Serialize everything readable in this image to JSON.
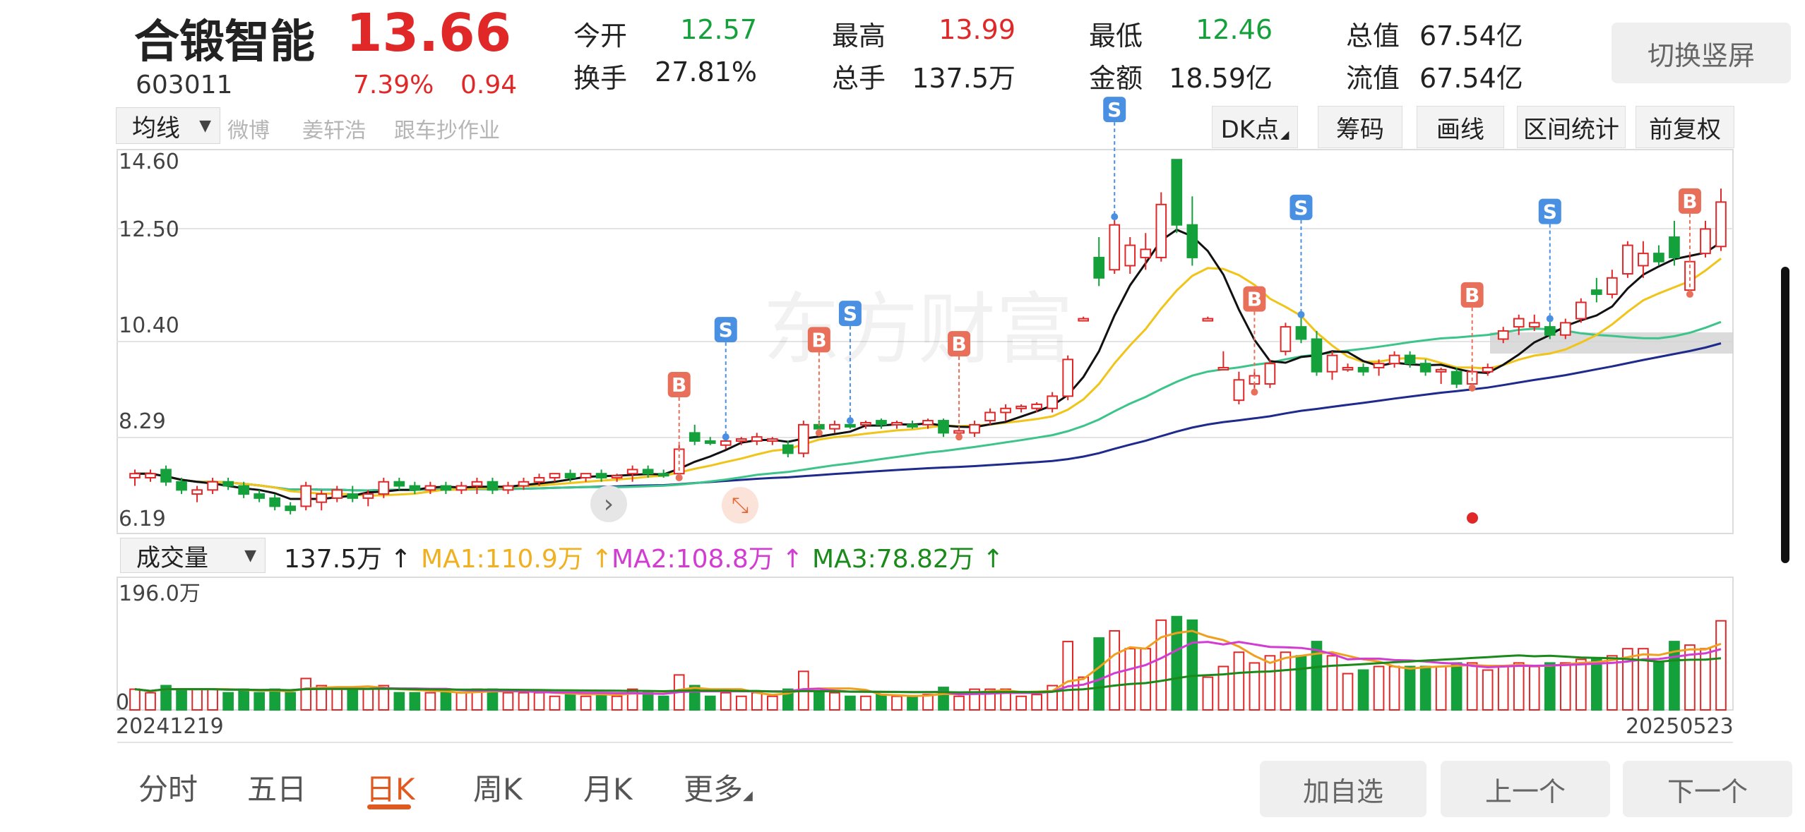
{
  "stock": {
    "name": "合锻智能",
    "price": "13.66",
    "code": "603011",
    "change_pct": "7.39%",
    "change_amt": "0.94"
  },
  "quote": [
    {
      "label": "今开",
      "value": "12.57",
      "color": "green"
    },
    {
      "label": "最高",
      "value": "13.99",
      "color": "red"
    },
    {
      "label": "最低",
      "value": "12.46",
      "color": "green"
    },
    {
      "label": "总值",
      "value": "67.54亿",
      "color": "black"
    },
    {
      "label": "换手",
      "value": "27.81%",
      "color": "black"
    },
    {
      "label": "总手",
      "value": "137.5万",
      "color": "black"
    },
    {
      "label": "金额",
      "value": "18.59亿",
      "color": "black"
    },
    {
      "label": "流值",
      "value": "67.54亿",
      "color": "black"
    }
  ],
  "switch_button": "切换竖屏",
  "chart_toolbar": {
    "ma_selector": "均线",
    "faded_tags": [
      "微博",
      "姜轩浩",
      "跟车抄作业"
    ],
    "buttons": [
      "DK点",
      "筹码",
      "画线",
      "区间统计",
      "前复权"
    ]
  },
  "price_axis": [
    "14.60",
    "12.50",
    "10.40",
    "8.29",
    "6.19"
  ],
  "watermark": "东方财富",
  "volume_panel": {
    "selector": "成交量",
    "current": "137.5万",
    "ma1": "MA1:110.9万",
    "ma2": "MA2:108.8万",
    "ma3": "MA3:78.82万",
    "axis_top": "196.0万",
    "axis_zero": "0"
  },
  "date_range": {
    "start": "20241219",
    "end": "20250523"
  },
  "period_tabs": [
    "分时",
    "五日",
    "日K",
    "周K",
    "月K",
    "更多"
  ],
  "active_tab": "日K",
  "bottom_buttons": [
    "加自选",
    "上一个",
    "下一个"
  ],
  "colors": {
    "up": "#e02828",
    "down": "#14a03a",
    "ma_black": "#111111",
    "ma_yellow": "#f0c419",
    "ma_teal": "#3cc48a",
    "ma_navy": "#1e2a8c",
    "vol_ma1": "#f0a020",
    "vol_ma2": "#d23cd2",
    "vol_ma3": "#1a8a1a",
    "buy_signal": "#e8705a",
    "sell_signal": "#4a90e2",
    "active_tab": "#e05a20"
  },
  "chart_data": {
    "type": "candlestick",
    "x_start": "20241219",
    "x_end": "20250523",
    "ylim": [
      6.19,
      14.6
    ],
    "candles": [
      {
        "o": 6.9,
        "h": 7.1,
        "l": 6.7,
        "c": 7.0
      },
      {
        "o": 6.9,
        "h": 7.1,
        "l": 6.8,
        "c": 7.0
      },
      {
        "o": 7.1,
        "h": 7.2,
        "l": 6.7,
        "c": 6.8
      },
      {
        "o": 6.8,
        "h": 6.9,
        "l": 6.5,
        "c": 6.6
      },
      {
        "o": 6.5,
        "h": 6.7,
        "l": 6.3,
        "c": 6.6
      },
      {
        "o": 6.6,
        "h": 6.9,
        "l": 6.5,
        "c": 6.8
      },
      {
        "o": 6.8,
        "h": 6.9,
        "l": 6.6,
        "c": 6.7
      },
      {
        "o": 6.7,
        "h": 6.8,
        "l": 6.4,
        "c": 6.5
      },
      {
        "o": 6.5,
        "h": 6.6,
        "l": 6.3,
        "c": 6.4
      },
      {
        "o": 6.4,
        "h": 6.5,
        "l": 6.1,
        "c": 6.2
      },
      {
        "o": 6.2,
        "h": 6.3,
        "l": 6.0,
        "c": 6.1
      },
      {
        "o": 6.2,
        "h": 6.8,
        "l": 6.1,
        "c": 6.7
      },
      {
        "o": 6.3,
        "h": 6.6,
        "l": 6.1,
        "c": 6.5
      },
      {
        "o": 6.4,
        "h": 6.7,
        "l": 6.3,
        "c": 6.6
      },
      {
        "o": 6.5,
        "h": 6.7,
        "l": 6.3,
        "c": 6.4
      },
      {
        "o": 6.4,
        "h": 6.6,
        "l": 6.2,
        "c": 6.5
      },
      {
        "o": 6.5,
        "h": 6.9,
        "l": 6.4,
        "c": 6.8
      },
      {
        "o": 6.8,
        "h": 6.9,
        "l": 6.6,
        "c": 6.7
      },
      {
        "o": 6.7,
        "h": 6.8,
        "l": 6.5,
        "c": 6.6
      },
      {
        "o": 6.6,
        "h": 6.8,
        "l": 6.5,
        "c": 6.7
      },
      {
        "o": 6.7,
        "h": 6.8,
        "l": 6.5,
        "c": 6.6
      },
      {
        "o": 6.6,
        "h": 6.8,
        "l": 6.5,
        "c": 6.7
      },
      {
        "o": 6.7,
        "h": 6.9,
        "l": 6.5,
        "c": 6.8
      },
      {
        "o": 6.8,
        "h": 6.9,
        "l": 6.5,
        "c": 6.6
      },
      {
        "o": 6.6,
        "h": 6.8,
        "l": 6.5,
        "c": 6.7
      },
      {
        "o": 6.7,
        "h": 6.9,
        "l": 6.6,
        "c": 6.8
      },
      {
        "o": 6.8,
        "h": 7.0,
        "l": 6.7,
        "c": 6.9
      },
      {
        "o": 6.9,
        "h": 7.0,
        "l": 6.8,
        "c": 7.0
      },
      {
        "o": 7.0,
        "h": 7.1,
        "l": 6.8,
        "c": 6.9
      },
      {
        "o": 6.9,
        "h": 7.0,
        "l": 6.8,
        "c": 7.0
      },
      {
        "o": 7.0,
        "h": 7.1,
        "l": 6.8,
        "c": 6.9
      },
      {
        "o": 6.9,
        "h": 7.0,
        "l": 6.8,
        "c": 6.95
      },
      {
        "o": 7.0,
        "h": 7.2,
        "l": 6.8,
        "c": 7.1
      },
      {
        "o": 7.1,
        "h": 7.2,
        "l": 6.9,
        "c": 7.0
      },
      {
        "o": 7.0,
        "h": 7.1,
        "l": 6.9,
        "c": 6.95
      },
      {
        "o": 7.0,
        "h": 7.7,
        "l": 6.9,
        "c": 7.6
      },
      {
        "o": 8.0,
        "h": 8.2,
        "l": 7.7,
        "c": 7.8
      },
      {
        "o": 7.8,
        "h": 7.9,
        "l": 7.7,
        "c": 7.75
      },
      {
        "o": 7.7,
        "h": 7.9,
        "l": 7.6,
        "c": 7.8
      },
      {
        "o": 7.8,
        "h": 7.9,
        "l": 7.7,
        "c": 7.85
      },
      {
        "o": 7.8,
        "h": 8.0,
        "l": 7.7,
        "c": 7.9
      },
      {
        "o": 7.8,
        "h": 7.9,
        "l": 7.7,
        "c": 7.85
      },
      {
        "o": 7.7,
        "h": 7.8,
        "l": 7.4,
        "c": 7.5
      },
      {
        "o": 7.5,
        "h": 8.3,
        "l": 7.4,
        "c": 8.2
      },
      {
        "o": 8.2,
        "h": 8.3,
        "l": 8.0,
        "c": 8.1
      },
      {
        "o": 8.1,
        "h": 8.3,
        "l": 8.0,
        "c": 8.2
      },
      {
        "o": 8.2,
        "h": 8.3,
        "l": 8.1,
        "c": 8.15
      },
      {
        "o": 8.2,
        "h": 8.3,
        "l": 8.1,
        "c": 8.25
      },
      {
        "o": 8.3,
        "h": 8.35,
        "l": 8.1,
        "c": 8.2
      },
      {
        "o": 8.2,
        "h": 8.3,
        "l": 8.1,
        "c": 8.25
      },
      {
        "o": 8.2,
        "h": 8.3,
        "l": 8.1,
        "c": 8.15
      },
      {
        "o": 8.2,
        "h": 8.35,
        "l": 8.1,
        "c": 8.3
      },
      {
        "o": 8.3,
        "h": 8.35,
        "l": 7.9,
        "c": 8.0
      },
      {
        "o": 8.0,
        "h": 8.1,
        "l": 7.9,
        "c": 8.05
      },
      {
        "o": 8.0,
        "h": 8.3,
        "l": 7.9,
        "c": 8.2
      },
      {
        "o": 8.3,
        "h": 8.6,
        "l": 8.2,
        "c": 8.5
      },
      {
        "o": 8.5,
        "h": 8.7,
        "l": 8.3,
        "c": 8.6
      },
      {
        "o": 8.6,
        "h": 8.7,
        "l": 8.5,
        "c": 8.65
      },
      {
        "o": 8.6,
        "h": 8.75,
        "l": 8.5,
        "c": 8.7
      },
      {
        "o": 8.6,
        "h": 9.0,
        "l": 8.5,
        "c": 8.9
      },
      {
        "o": 8.9,
        "h": 9.9,
        "l": 8.8,
        "c": 9.8
      },
      {
        "o": 10.8,
        "h": 10.85,
        "l": 10.75,
        "c": 10.8
      },
      {
        "o": 12.3,
        "h": 12.8,
        "l": 11.6,
        "c": 11.8
      },
      {
        "o": 12.0,
        "h": 13.3,
        "l": 11.9,
        "c": 13.1
      },
      {
        "o": 12.1,
        "h": 12.8,
        "l": 11.9,
        "c": 12.6
      },
      {
        "o": 12.3,
        "h": 12.9,
        "l": 12.0,
        "c": 12.5
      },
      {
        "o": 12.3,
        "h": 13.9,
        "l": 12.2,
        "c": 13.6
      },
      {
        "o": 14.7,
        "h": 14.7,
        "l": 12.9,
        "c": 13.1
      },
      {
        "o": 13.1,
        "h": 13.8,
        "l": 12.1,
        "c": 12.3
      },
      {
        "o": 10.8,
        "h": 10.85,
        "l": 10.75,
        "c": 10.8
      },
      {
        "o": 9.6,
        "h": 10.0,
        "l": 9.6,
        "c": 9.6
      },
      {
        "o": 8.8,
        "h": 9.5,
        "l": 8.7,
        "c": 9.3
      },
      {
        "o": 9.2,
        "h": 9.5,
        "l": 9.0,
        "c": 9.4
      },
      {
        "o": 9.2,
        "h": 9.8,
        "l": 9.1,
        "c": 9.7
      },
      {
        "o": 10.0,
        "h": 10.7,
        "l": 9.9,
        "c": 10.6
      },
      {
        "o": 10.6,
        "h": 10.9,
        "l": 10.2,
        "c": 10.3
      },
      {
        "o": 10.3,
        "h": 10.5,
        "l": 9.4,
        "c": 9.5
      },
      {
        "o": 9.5,
        "h": 10.0,
        "l": 9.3,
        "c": 9.9
      },
      {
        "o": 9.6,
        "h": 9.7,
        "l": 9.5,
        "c": 9.6
      },
      {
        "o": 9.6,
        "h": 9.7,
        "l": 9.4,
        "c": 9.5
      },
      {
        "o": 9.6,
        "h": 9.8,
        "l": 9.4,
        "c": 9.7
      },
      {
        "o": 9.7,
        "h": 10.0,
        "l": 9.6,
        "c": 9.9
      },
      {
        "o": 9.9,
        "h": 10.0,
        "l": 9.6,
        "c": 9.7
      },
      {
        "o": 9.7,
        "h": 9.8,
        "l": 9.4,
        "c": 9.5
      },
      {
        "o": 9.5,
        "h": 9.6,
        "l": 9.2,
        "c": 9.55
      },
      {
        "o": 9.5,
        "h": 9.6,
        "l": 9.1,
        "c": 9.2
      },
      {
        "o": 9.2,
        "h": 9.6,
        "l": 9.1,
        "c": 9.5
      },
      {
        "o": 9.5,
        "h": 9.7,
        "l": 9.4,
        "c": 9.6
      },
      {
        "o": 10.3,
        "h": 10.6,
        "l": 10.2,
        "c": 10.5
      },
      {
        "o": 10.6,
        "h": 10.9,
        "l": 10.4,
        "c": 10.8
      },
      {
        "o": 10.6,
        "h": 10.9,
        "l": 10.5,
        "c": 10.7
      },
      {
        "o": 10.6,
        "h": 10.8,
        "l": 10.3,
        "c": 10.4
      },
      {
        "o": 10.4,
        "h": 10.8,
        "l": 10.3,
        "c": 10.7
      },
      {
        "o": 10.8,
        "h": 11.3,
        "l": 10.7,
        "c": 11.2
      },
      {
        "o": 11.5,
        "h": 11.8,
        "l": 11.2,
        "c": 11.4
      },
      {
        "o": 11.4,
        "h": 12.0,
        "l": 11.3,
        "c": 11.8
      },
      {
        "o": 11.9,
        "h": 12.7,
        "l": 11.8,
        "c": 12.6
      },
      {
        "o": 12.1,
        "h": 12.7,
        "l": 11.8,
        "c": 12.4
      },
      {
        "o": 12.4,
        "h": 12.6,
        "l": 12.1,
        "c": 12.2
      },
      {
        "o": 12.8,
        "h": 13.2,
        "l": 12.1,
        "c": 12.3
      },
      {
        "o": 11.5,
        "h": 12.4,
        "l": 11.4,
        "c": 12.2
      },
      {
        "o": 12.4,
        "h": 13.2,
        "l": 12.3,
        "c": 13.0
      },
      {
        "o": 12.57,
        "h": 13.99,
        "l": 12.46,
        "c": 13.66
      }
    ],
    "volume_max": 196.0,
    "volume_unit": "万",
    "volume_current": 137.5,
    "volume_ma": {
      "MA1": 110.9,
      "MA2": 108.8,
      "MA3": 78.82
    },
    "signals": [
      {
        "type": "B",
        "index": 35
      },
      {
        "type": "S",
        "index": 38
      },
      {
        "type": "B",
        "index": 44
      },
      {
        "type": "S",
        "index": 46
      },
      {
        "type": "B",
        "index": 53
      },
      {
        "type": "S",
        "index": 63
      },
      {
        "type": "B",
        "index": 72
      },
      {
        "type": "S",
        "index": 75
      },
      {
        "type": "B",
        "index": 86
      },
      {
        "type": "S",
        "index": 91
      },
      {
        "type": "B",
        "index": 100
      }
    ]
  }
}
